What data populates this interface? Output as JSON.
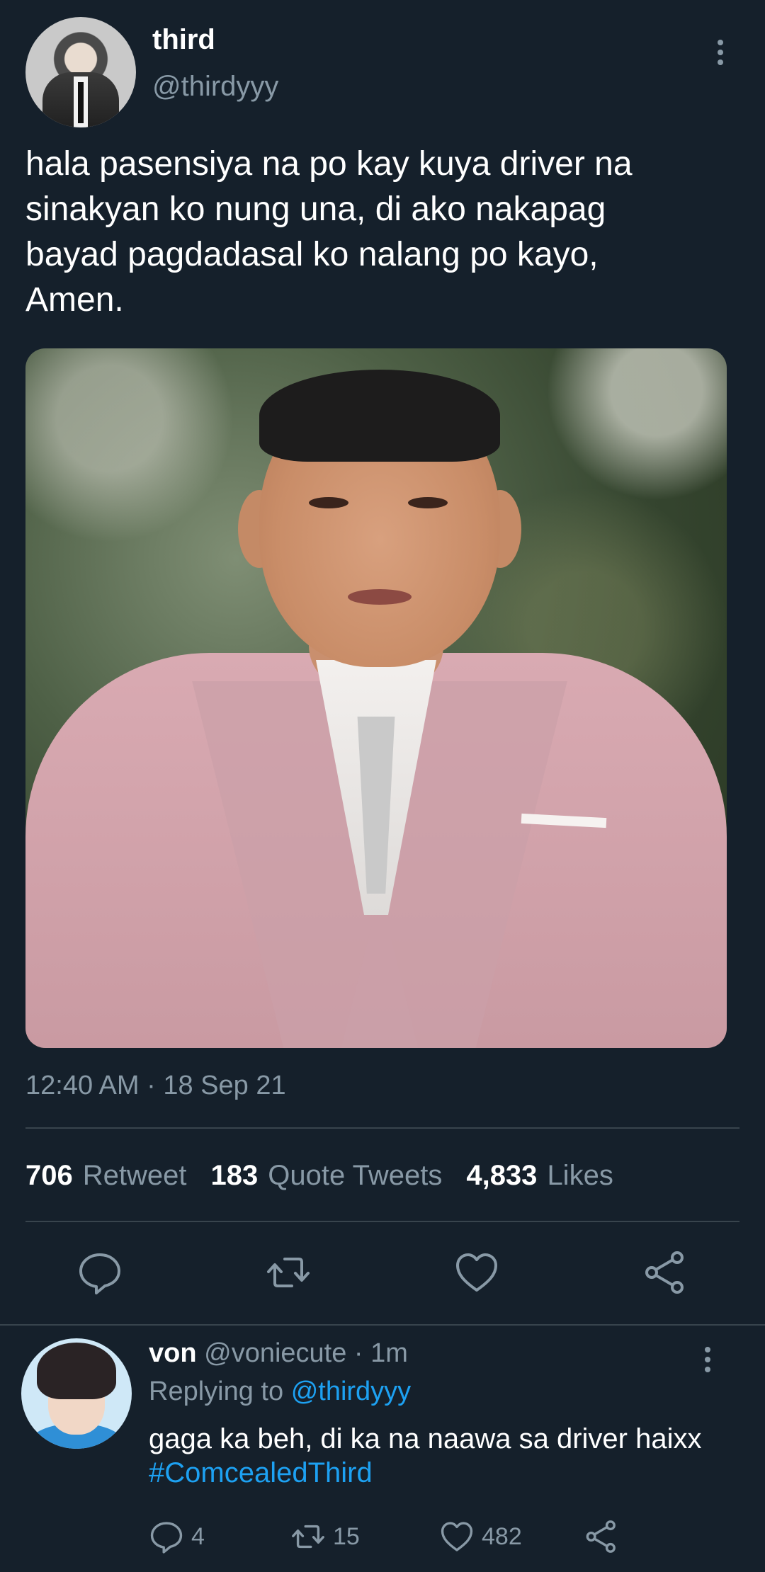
{
  "tweet": {
    "display_name": "third",
    "handle": "@thirdyyy",
    "text": "hala pasensiya na po kay kuya driver na\nsinakyan ko nung una, di ako nakapag\nbayad pagdadasal ko nalang po kayo,\nAmen.",
    "timestamp": "12:40 AM · 18 Sep 21",
    "stats": {
      "retweets": "706",
      "retweets_label": "Retweet",
      "quotes": "183",
      "quotes_label": "Quote Tweets",
      "likes": "4,833",
      "likes_label": "Likes"
    },
    "actions": [
      "reply-icon",
      "retweet-icon",
      "like-icon",
      "share-icon"
    ]
  },
  "reply": {
    "display_name": "von",
    "meta": "@voniecute · 1m",
    "replying_prefix": "Replying to",
    "replying_handle": "@thirdyyy",
    "text_main": "gaga ka beh, di ka na naawa sa driver haixx",
    "hashtag": "#ComcealedThird",
    "reply_count": "4",
    "retweet_count": "15",
    "like_count": "482"
  },
  "colors": {
    "background": "#15202b",
    "muted": "#8899a6",
    "link": "#1da1f2",
    "divider": "#38444d"
  }
}
